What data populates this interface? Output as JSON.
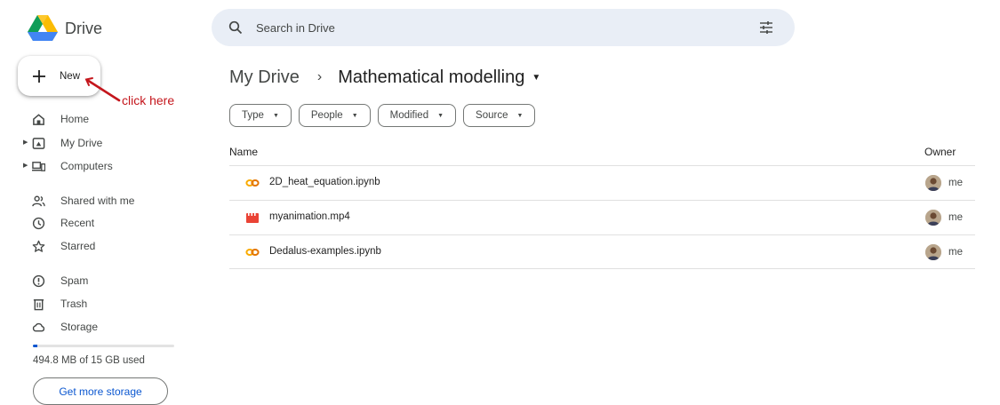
{
  "app": {
    "name": "Drive"
  },
  "search": {
    "placeholder": "Search in Drive"
  },
  "new_button": {
    "label": "New"
  },
  "annotation": {
    "text": "click here",
    "color": "#c4161c"
  },
  "sidebar": {
    "items": [
      {
        "label": "Home",
        "icon": "home-icon"
      },
      {
        "label": "My Drive",
        "icon": "my-drive-icon",
        "expandable": true
      },
      {
        "label": "Computers",
        "icon": "computers-icon",
        "expandable": true
      },
      {
        "label": "Shared with me",
        "icon": "shared-icon"
      },
      {
        "label": "Recent",
        "icon": "clock-icon"
      },
      {
        "label": "Starred",
        "icon": "star-icon"
      },
      {
        "label": "Spam",
        "icon": "spam-icon"
      },
      {
        "label": "Trash",
        "icon": "trash-icon"
      },
      {
        "label": "Storage",
        "icon": "cloud-icon"
      }
    ]
  },
  "storage": {
    "used_text": "494.8 MB of 15 GB used",
    "used_fraction": 0.033,
    "button_label": "Get more storage"
  },
  "breadcrumb": {
    "root": "My Drive",
    "separator": "›",
    "current": "Mathematical modelling"
  },
  "filters": [
    "Type",
    "People",
    "Modified",
    "Source"
  ],
  "table": {
    "columns": {
      "name": "Name",
      "owner": "Owner"
    },
    "rows": [
      {
        "name": "2D_heat_equation.ipynb",
        "type": "colab",
        "owner": "me"
      },
      {
        "name": "myanimation.mp4",
        "type": "video",
        "owner": "me"
      },
      {
        "name": "Dedalus-examples.ipynb",
        "type": "colab",
        "owner": "me"
      }
    ]
  },
  "colors": {
    "accent": "#0b57d0",
    "search_bg": "#e9eef6",
    "colab": "#f9ab00",
    "video": "#ea4335"
  }
}
